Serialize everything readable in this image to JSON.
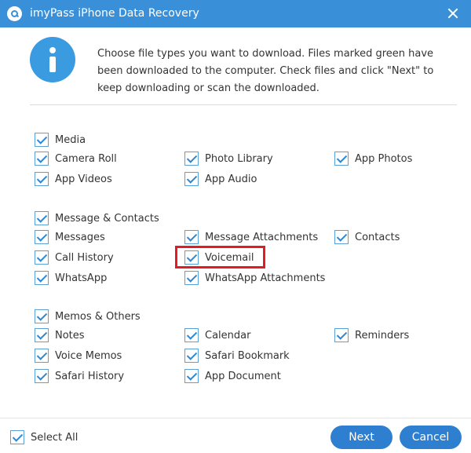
{
  "window": {
    "title": "imyPass iPhone Data Recovery"
  },
  "message": "Choose file types you want to download. Files marked green have been downloaded to the computer. Check files and click \"Next\" to keep downloading or scan the downloaded.",
  "sections": {
    "media": {
      "label": "Media",
      "items": [
        "Camera Roll",
        "Photo Library",
        "App Photos",
        "App Videos",
        "App Audio"
      ]
    },
    "messages": {
      "label": "Message & Contacts",
      "items": [
        "Messages",
        "Message Attachments",
        "Contacts",
        "Call History",
        "Voicemail",
        "WhatsApp",
        "WhatsApp Attachments"
      ]
    },
    "memos": {
      "label": "Memos & Others",
      "items": [
        "Notes",
        "Calendar",
        "Reminders",
        "Voice Memos",
        "Safari Bookmark",
        "Safari History",
        "App Document"
      ]
    }
  },
  "footer": {
    "select_all": "Select All",
    "next": "Next",
    "cancel": "Cancel"
  },
  "colors": {
    "titlebar": "#3a8fd9",
    "accent": "#2e7fcf",
    "highlight": "#e21c24"
  }
}
